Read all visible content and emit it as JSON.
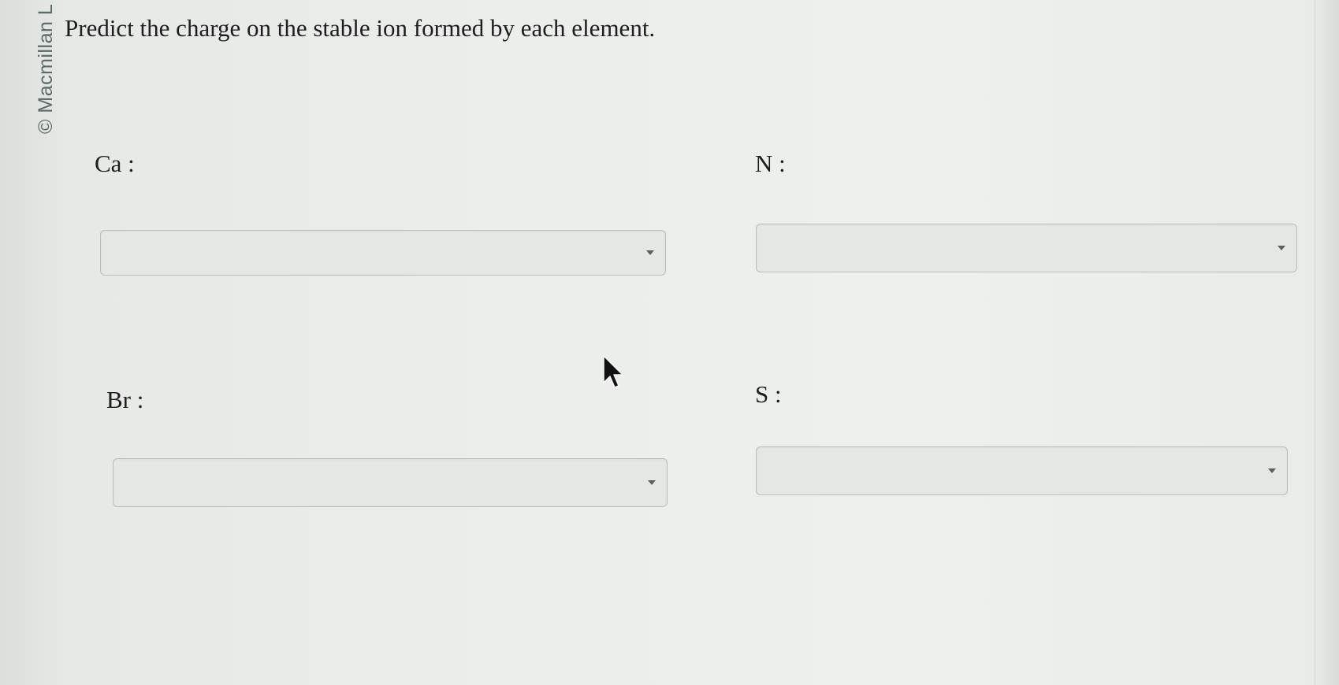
{
  "watermark": {
    "text": "© Macmillan L"
  },
  "question": {
    "text": "Predict the charge on the stable ion formed by each element."
  },
  "fields": [
    {
      "label": "Ca :",
      "selected_value": ""
    },
    {
      "label": "N :",
      "selected_value": ""
    },
    {
      "label": "Br :",
      "selected_value": ""
    },
    {
      "label": "S :",
      "selected_value": ""
    }
  ],
  "icons": {
    "dropdown": "chevron-down-icon",
    "pointer": "mouse-pointer-icon"
  }
}
